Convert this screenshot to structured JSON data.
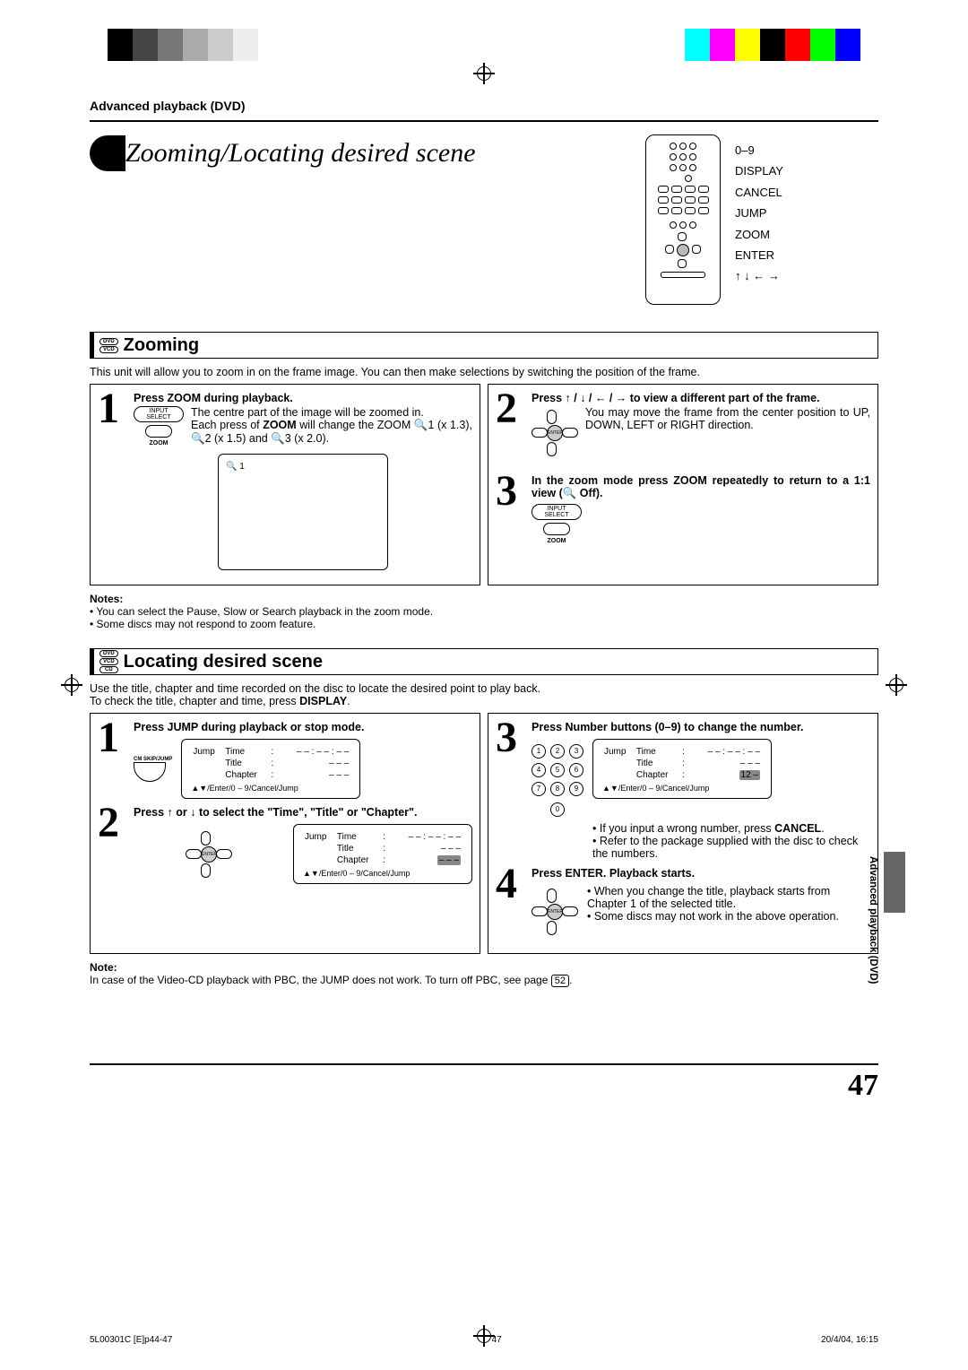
{
  "header": {
    "section_label": "Advanced playback (DVD)"
  },
  "title": "Zooming/Locating desired scene",
  "remote_labels": [
    "0–9",
    "DISPLAY",
    "CANCEL",
    "JUMP",
    "ZOOM",
    "ENTER",
    "↑ ↓ ← →"
  ],
  "zooming": {
    "badges": [
      "DVD",
      "VCD"
    ],
    "heading": "Zooming",
    "intro": "This unit will allow you to zoom in on the frame image. You can then make selections by switching the position of the frame.",
    "step1": {
      "title": "Press ZOOM during playback.",
      "body1": "The centre part of the image will be zoomed in.",
      "body2_a": "Each press of ",
      "body2_b": "ZOOM",
      "body2_c": " will change the ZOOM 🔍1 (x 1.3), 🔍2 (x 1.5) and 🔍3 (x 2.0).",
      "btn_top": "INPUT SELECT",
      "btn_bot": "ZOOM",
      "screen_label": "🔍 1"
    },
    "step2": {
      "title": "Press ↑ / ↓ / ← / → to view a different part of the frame.",
      "body": "You may move the frame from the center position to UP, DOWN, LEFT or RIGHT direction."
    },
    "step3": {
      "title": "In the zoom mode press ZOOM repeatedly to return to a 1:1 view (🔍 Off).",
      "btn_top": "INPUT SELECT",
      "btn_bot": "ZOOM"
    },
    "notes_title": "Notes:",
    "note1": "• You can select the Pause, Slow or Search playback in the zoom mode.",
    "note2": "• Some discs may not respond to zoom feature."
  },
  "locating": {
    "badges": [
      "DVD",
      "VCD",
      "CD"
    ],
    "heading": "Locating desired scene",
    "intro1": "Use the title, chapter and time recorded on the disc to locate the desired point to play back.",
    "intro2a": "To check the title, chapter and time, press ",
    "intro2b": "DISPLAY",
    "intro2c": ".",
    "step1": {
      "title": "Press JUMP during playback or stop mode.",
      "btn_label": "CM SKIP/JUMP",
      "osd": {
        "l1": "Jump",
        "time": "Time",
        "time_v": "– – : – – : – –",
        "title": "Title",
        "title_v": "– – –",
        "chapter": "Chapter",
        "chapter_v": "– – –",
        "hint": "▲▼/Enter/0 – 9/Cancel/Jump"
      }
    },
    "step2": {
      "title": "Press ↑ or ↓ to select the \"Time\", \"Title\" or \"Chapter\".",
      "osd": {
        "l1": "Jump",
        "time": "Time",
        "time_v": "– – : – – : – –",
        "title": "Title",
        "title_v": "– – –",
        "chapter": "Chapter",
        "chapter_v": "– – –",
        "chapter_hl": true,
        "hint": "▲▼/Enter/0 – 9/Cancel/Jump"
      }
    },
    "step3": {
      "title": "Press Number buttons (0–9) to change the number.",
      "osd": {
        "l1": "Jump",
        "time": "Time",
        "time_v": "– – : – – : – –",
        "title": "Title",
        "title_v": "– – –",
        "chapter": "Chapter",
        "chapter_v": "12 –",
        "chapter_hl": true,
        "hint": "▲▼/Enter/0 – 9/Cancel/Jump"
      },
      "bullet1a": "• If you input a wrong number, press ",
      "bullet1b": "CANCEL",
      "bullet1c": ".",
      "bullet2": "• Refer to the package supplied with the disc to check the numbers."
    },
    "step4": {
      "title": "Press ENTER. Playback starts.",
      "bullet1": "• When you change the title, playback starts from Chapter 1 of the selected title.",
      "bullet2": "• Some discs may not work in the above operation."
    },
    "note_title": "Note:",
    "note_a": "In case of the Video-CD playback with PBC, the JUMP does not work. To turn off PBC, see page ",
    "note_pg": "52",
    "note_c": "."
  },
  "side_tab": "Advanced playback (DVD)",
  "page_number": "47",
  "footer": {
    "left": "5L00301C [E]p44-47",
    "center": "47",
    "right": "20/4/04, 16:15"
  }
}
